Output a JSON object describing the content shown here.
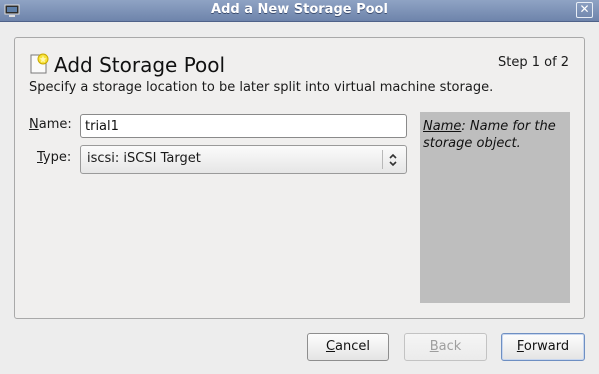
{
  "window": {
    "title": "Add a New Storage Pool",
    "close_glyph": "✕"
  },
  "header": {
    "title": "Add Storage Pool",
    "step": "Step 1 of 2",
    "subtitle": "Specify a storage location to be later split into virtual machine storage."
  },
  "form": {
    "name_label_mnemonic": "N",
    "name_label_rest": "ame:",
    "name_value": "trial1",
    "type_label_mnemonic": "T",
    "type_label_rest": "ype:",
    "type_value": "iscsi: iSCSI Target"
  },
  "help": {
    "term": "Name",
    "text": ": Name for the storage object."
  },
  "buttons": {
    "cancel_mnemonic": "C",
    "cancel_rest": "ancel",
    "back_mnemonic": "B",
    "back_rest": "ack",
    "forward_mnemonic": "F",
    "forward_rest": "orward"
  },
  "icons": {
    "window": "monitor-icon",
    "header": "new-storage-pool-icon",
    "select": "chevron-updown-icon"
  },
  "colors": {
    "titlebar": "#7b8fb5",
    "help_bg": "#bebebe",
    "window_bg": "#ededed"
  }
}
